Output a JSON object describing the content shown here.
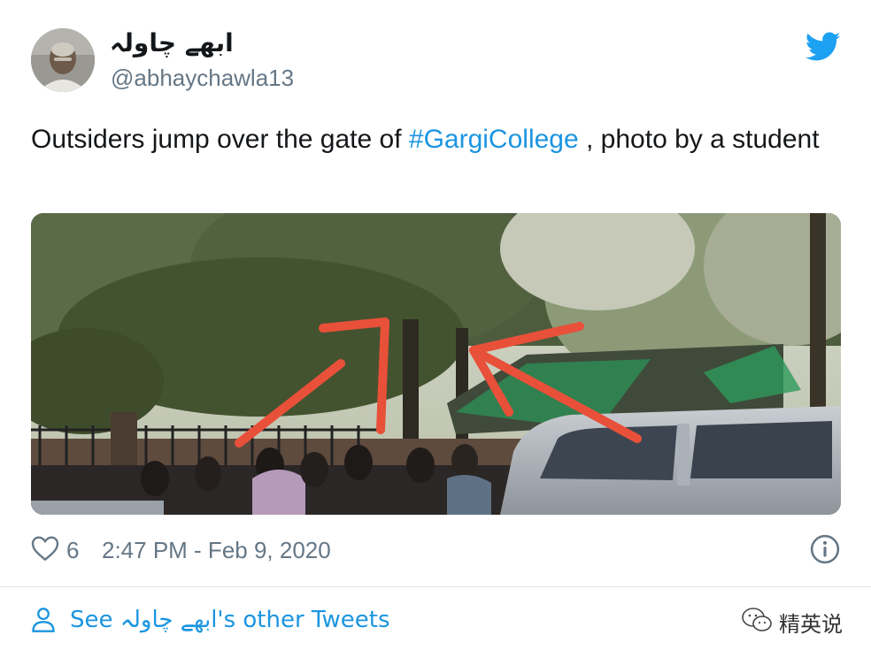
{
  "author": {
    "name": "ابھے چاولہ",
    "handle": "@abhaychawla13"
  },
  "tweet": {
    "text_before": "Outsiders jump over the gate of ",
    "hashtag": "#GargiCollege",
    "text_after": " ,  photo by a student"
  },
  "media": {
    "icon": "photo-of-crowd-at-college-gate-with-red-arrows"
  },
  "footer": {
    "like_icon": "heart-icon",
    "like_count": "6",
    "timestamp": "2:47 PM - Feb 9, 2020",
    "info_icon": "info-icon"
  },
  "see_more": {
    "icon": "person-icon",
    "label": "See ابھے چاولہ's other Tweets"
  },
  "watermark": {
    "icon": "wechat-icon",
    "text": "精英说"
  },
  "colors": {
    "link": "#1b95e0",
    "muted": "#657786",
    "twitter_blue": "#1da1f2",
    "arrow_red": "#e8503a"
  }
}
